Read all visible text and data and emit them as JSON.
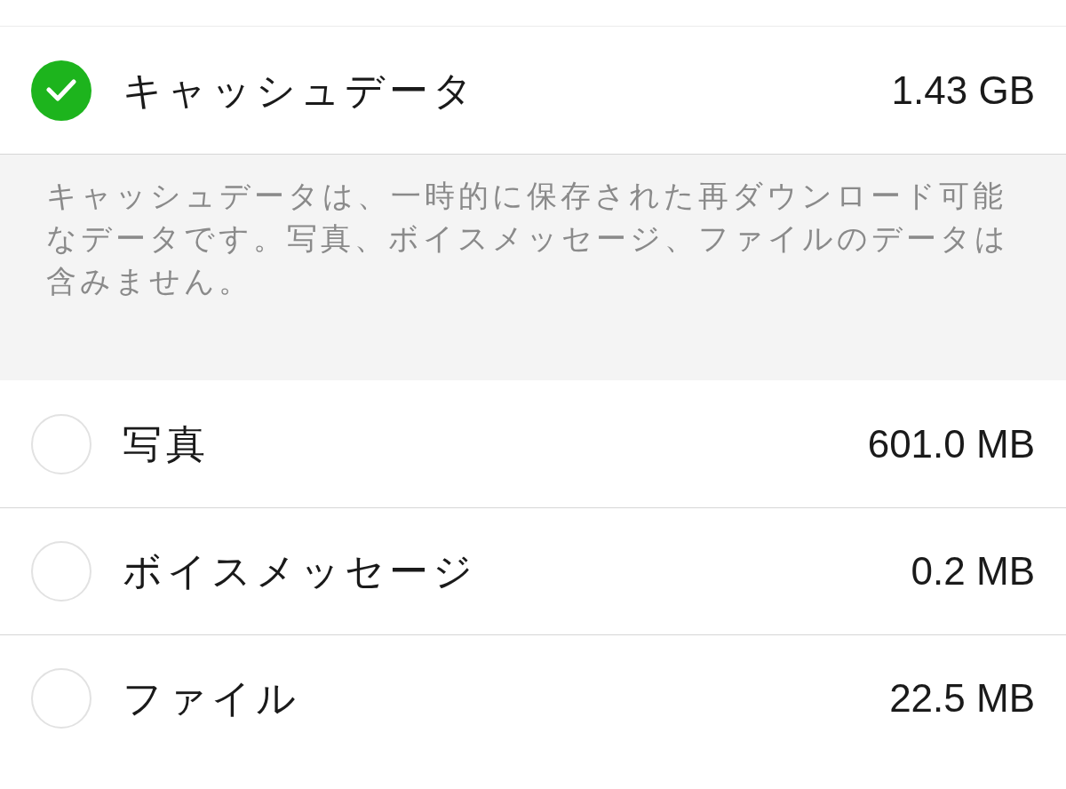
{
  "items": [
    {
      "label": "キャッシュデータ",
      "size": "1.43 GB",
      "checked": true,
      "description": "キャッシュデータは、一時的に保存された再ダウンロード可能なデータです。写真、ボイスメッセージ、ファイルのデータは含みません。"
    },
    {
      "label": "写真",
      "size": "601.0 MB",
      "checked": false
    },
    {
      "label": "ボイスメッセージ",
      "size": "0.2 MB",
      "checked": false
    },
    {
      "label": "ファイル",
      "size": "22.5 MB",
      "checked": false
    }
  ]
}
